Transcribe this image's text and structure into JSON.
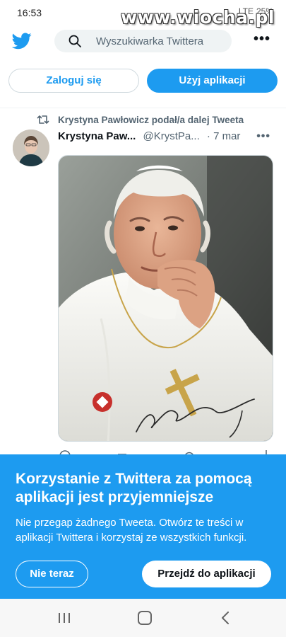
{
  "status_bar": {
    "time": "16:53",
    "battery": "25%",
    "network": "LTE"
  },
  "watermark": "www.wiocha.pl",
  "header": {
    "search_placeholder": "Wyszukiwarka Twittera",
    "more_icon": "more-horizontal-icon"
  },
  "auth": {
    "login_label": "Zaloguj się",
    "app_label": "Użyj aplikacji"
  },
  "tweet": {
    "retweet_text": "Krystyna Pawłowicz podał/a dalej Tweeta",
    "author_name": "Krystyna Paw...",
    "author_handle": "@KrystPa...",
    "date": "· 7 mar"
  },
  "promo": {
    "title": "Korzystanie z Twittera za pomocą aplikacji jest przyjemniejsze",
    "description": "Nie przegap żadnego Tweeta. Otwórz te treści w aplikacji Twittera i korzystaj ze wszystkich funkcji.",
    "later_label": "Nie teraz",
    "open_label": "Przejdź do aplikacji"
  },
  "colors": {
    "accent": "#1d9bf0",
    "text": "#0f1419",
    "secondary": "#536471"
  }
}
